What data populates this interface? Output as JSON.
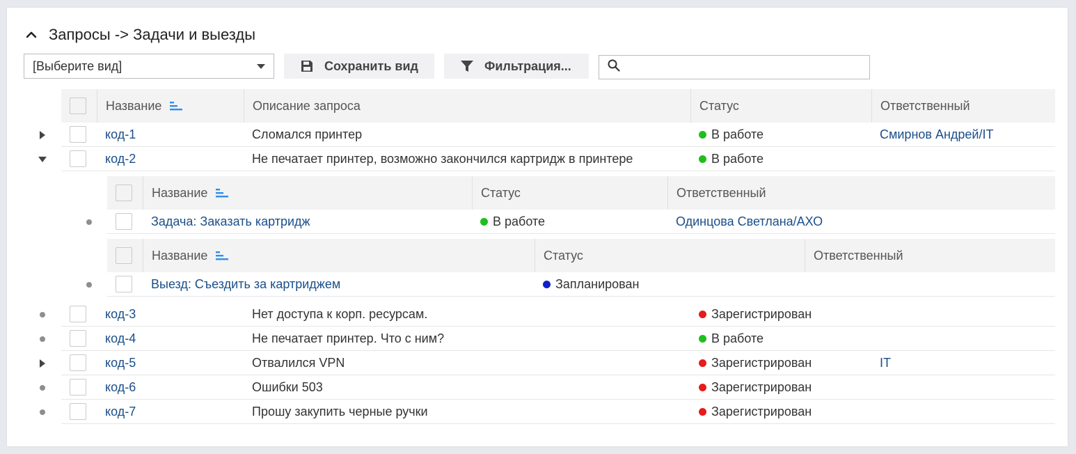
{
  "title": "Запросы -> Задачи и выезды",
  "toolbar": {
    "view_select": "[Выберите вид]",
    "save_label": "Сохранить вид",
    "filter_label": "Фильтрация...",
    "search_value": ""
  },
  "colors": {
    "green": "#1fbe1f",
    "red": "#e61b1b",
    "blue": "#0f22c8",
    "link": "#1a4f8a",
    "sort_icon": "#2f8ee8"
  },
  "main_table": {
    "headers": [
      "Название",
      "Описание запроса",
      "Статус",
      "Ответственный"
    ],
    "rows": [
      {
        "name": "код-1",
        "desc": "Сломался принтер",
        "status": "В работе",
        "status_color": "green",
        "owner": "Смирнов Андрей/IT",
        "expander": "collapsed"
      },
      {
        "name": "код-2",
        "desc": "Не печатает принтер, возможно закончился картридж в принтере",
        "status": "В работе",
        "status_color": "green",
        "owner": "",
        "expander": "expanded"
      },
      {
        "name": "код-3",
        "desc": "Нет доступа к корп. ресурсам.",
        "status": "Зарегистрирован",
        "status_color": "red",
        "owner": "",
        "expander": "leaf"
      },
      {
        "name": "код-4",
        "desc": "Не печатает принтер. Что с ним?",
        "status": "В работе",
        "status_color": "green",
        "owner": "",
        "expander": "leaf"
      },
      {
        "name": "код-5",
        "desc": "Отвалился VPN",
        "status": "Зарегистрирован",
        "status_color": "red",
        "owner": "IT",
        "expander": "collapsed"
      },
      {
        "name": "код-6",
        "desc": "Ошибки 503",
        "status": "Зарегистрирован",
        "status_color": "red",
        "owner": "",
        "expander": "leaf"
      },
      {
        "name": "код-7",
        "desc": "Прошу закупить черные ручки",
        "status": "Зарегистрирован",
        "status_color": "red",
        "owner": "",
        "expander": "leaf"
      }
    ]
  },
  "sub_tasks": {
    "headers": [
      "Название",
      "Статус",
      "Ответственный"
    ],
    "rows": [
      {
        "name": "Задача: Заказать картридж",
        "status": "В работе",
        "status_color": "green",
        "owner": "Одинцова Светлана/АХО"
      }
    ]
  },
  "sub_trips": {
    "headers": [
      "Название",
      "Статус",
      "Ответственный"
    ],
    "rows": [
      {
        "name": "Выезд: Съездить за картриджем",
        "status": "Запланирован",
        "status_color": "blue",
        "owner": ""
      }
    ]
  }
}
